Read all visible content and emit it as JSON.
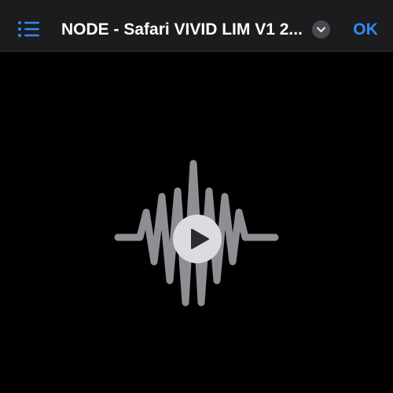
{
  "header": {
    "title": "NODE - Safari VIVID LIM V1 2...",
    "ok_label": "OK",
    "list_icon": "list-icon",
    "chevron_icon": "chevron-down-icon"
  },
  "media": {
    "waveform_icon": "waveform-icon",
    "play_icon": "play-icon"
  },
  "colors": {
    "accent": "#2f8cf0",
    "header_bg": "#1c1c1e",
    "background": "#000000",
    "waveform": "#8e8e93",
    "play_circle": "#dcdce0"
  }
}
